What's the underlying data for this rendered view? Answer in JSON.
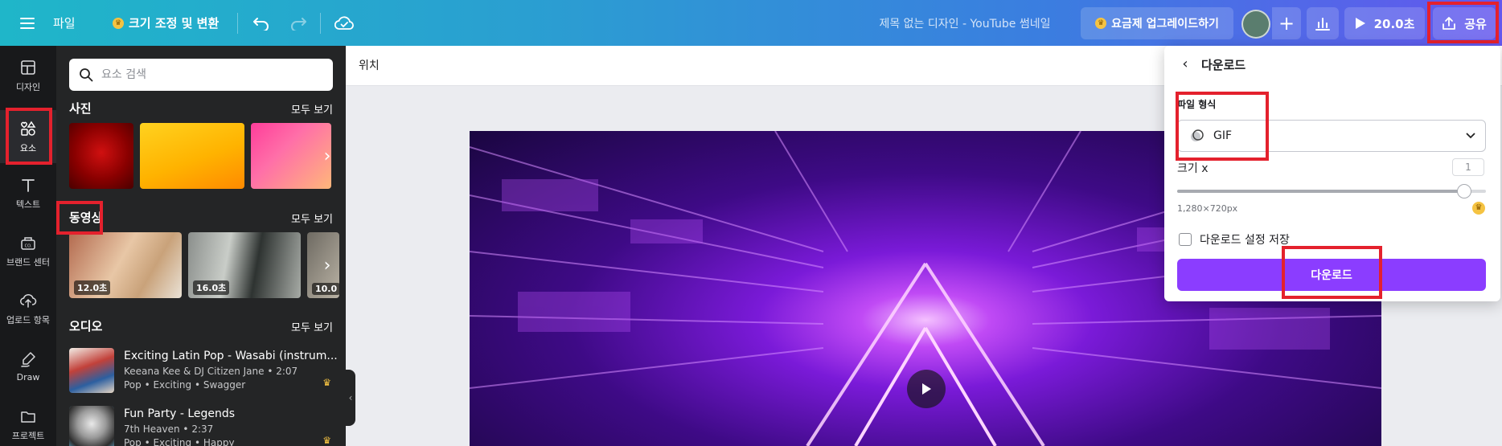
{
  "topbar": {
    "menu_icon": "hamburger-icon",
    "file_label": "파일",
    "resize_label": "크기 조정 및 변환",
    "design_title": "제목 없는 디자인 - YouTube 썸네일",
    "upgrade_label": "요금제 업그레이드하기",
    "add_label": "+",
    "duration_label": "20.0초",
    "share_label": "공유"
  },
  "rail": {
    "items": [
      {
        "label": "디자인",
        "icon": "layout-icon"
      },
      {
        "label": "요소",
        "icon": "elements-icon"
      },
      {
        "label": "텍스트",
        "icon": "text-icon"
      },
      {
        "label": "브랜드 센터",
        "icon": "brand-icon"
      },
      {
        "label": "업로드 항목",
        "icon": "upload-icon"
      },
      {
        "label": "Draw",
        "icon": "draw-icon"
      },
      {
        "label": "프로젝트",
        "icon": "folder-icon"
      }
    ]
  },
  "panel": {
    "search_placeholder": "요소 검색",
    "photos": {
      "title": "사진",
      "see_all": "모두 보기"
    },
    "videos": {
      "title": "동영상",
      "see_all": "모두 보기",
      "items": [
        {
          "duration": "12.0초"
        },
        {
          "duration": "16.0초"
        },
        {
          "duration": "10.0"
        }
      ]
    },
    "audio": {
      "title": "오디오",
      "see_all": "모두 보기",
      "items": [
        {
          "title": "Exciting Latin Pop - Wasabi (instrum...",
          "artist": "Keeana Kee & DJ Citizen Jane • 2:07",
          "tags": "Pop • Exciting • Swagger"
        },
        {
          "title": "Fun Party - Legends",
          "artist": "7th Heaven • 2:37",
          "tags": "Pop • Exciting • Happy"
        }
      ]
    }
  },
  "canvas": {
    "position_label": "위치"
  },
  "download_panel": {
    "title": "다운로드",
    "file_type_label": "파일 형식",
    "file_type_value": "GIF",
    "size_label": "크기 x",
    "size_value": "1",
    "size_slider_fraction": 0.93,
    "dimensions": "1,280×720px",
    "save_settings_label": "다운로드 설정 저장",
    "download_button": "다운로드"
  },
  "colors": {
    "accent": "#8b3dff",
    "highlight": "#e4212d",
    "premium": "#f5c342"
  }
}
